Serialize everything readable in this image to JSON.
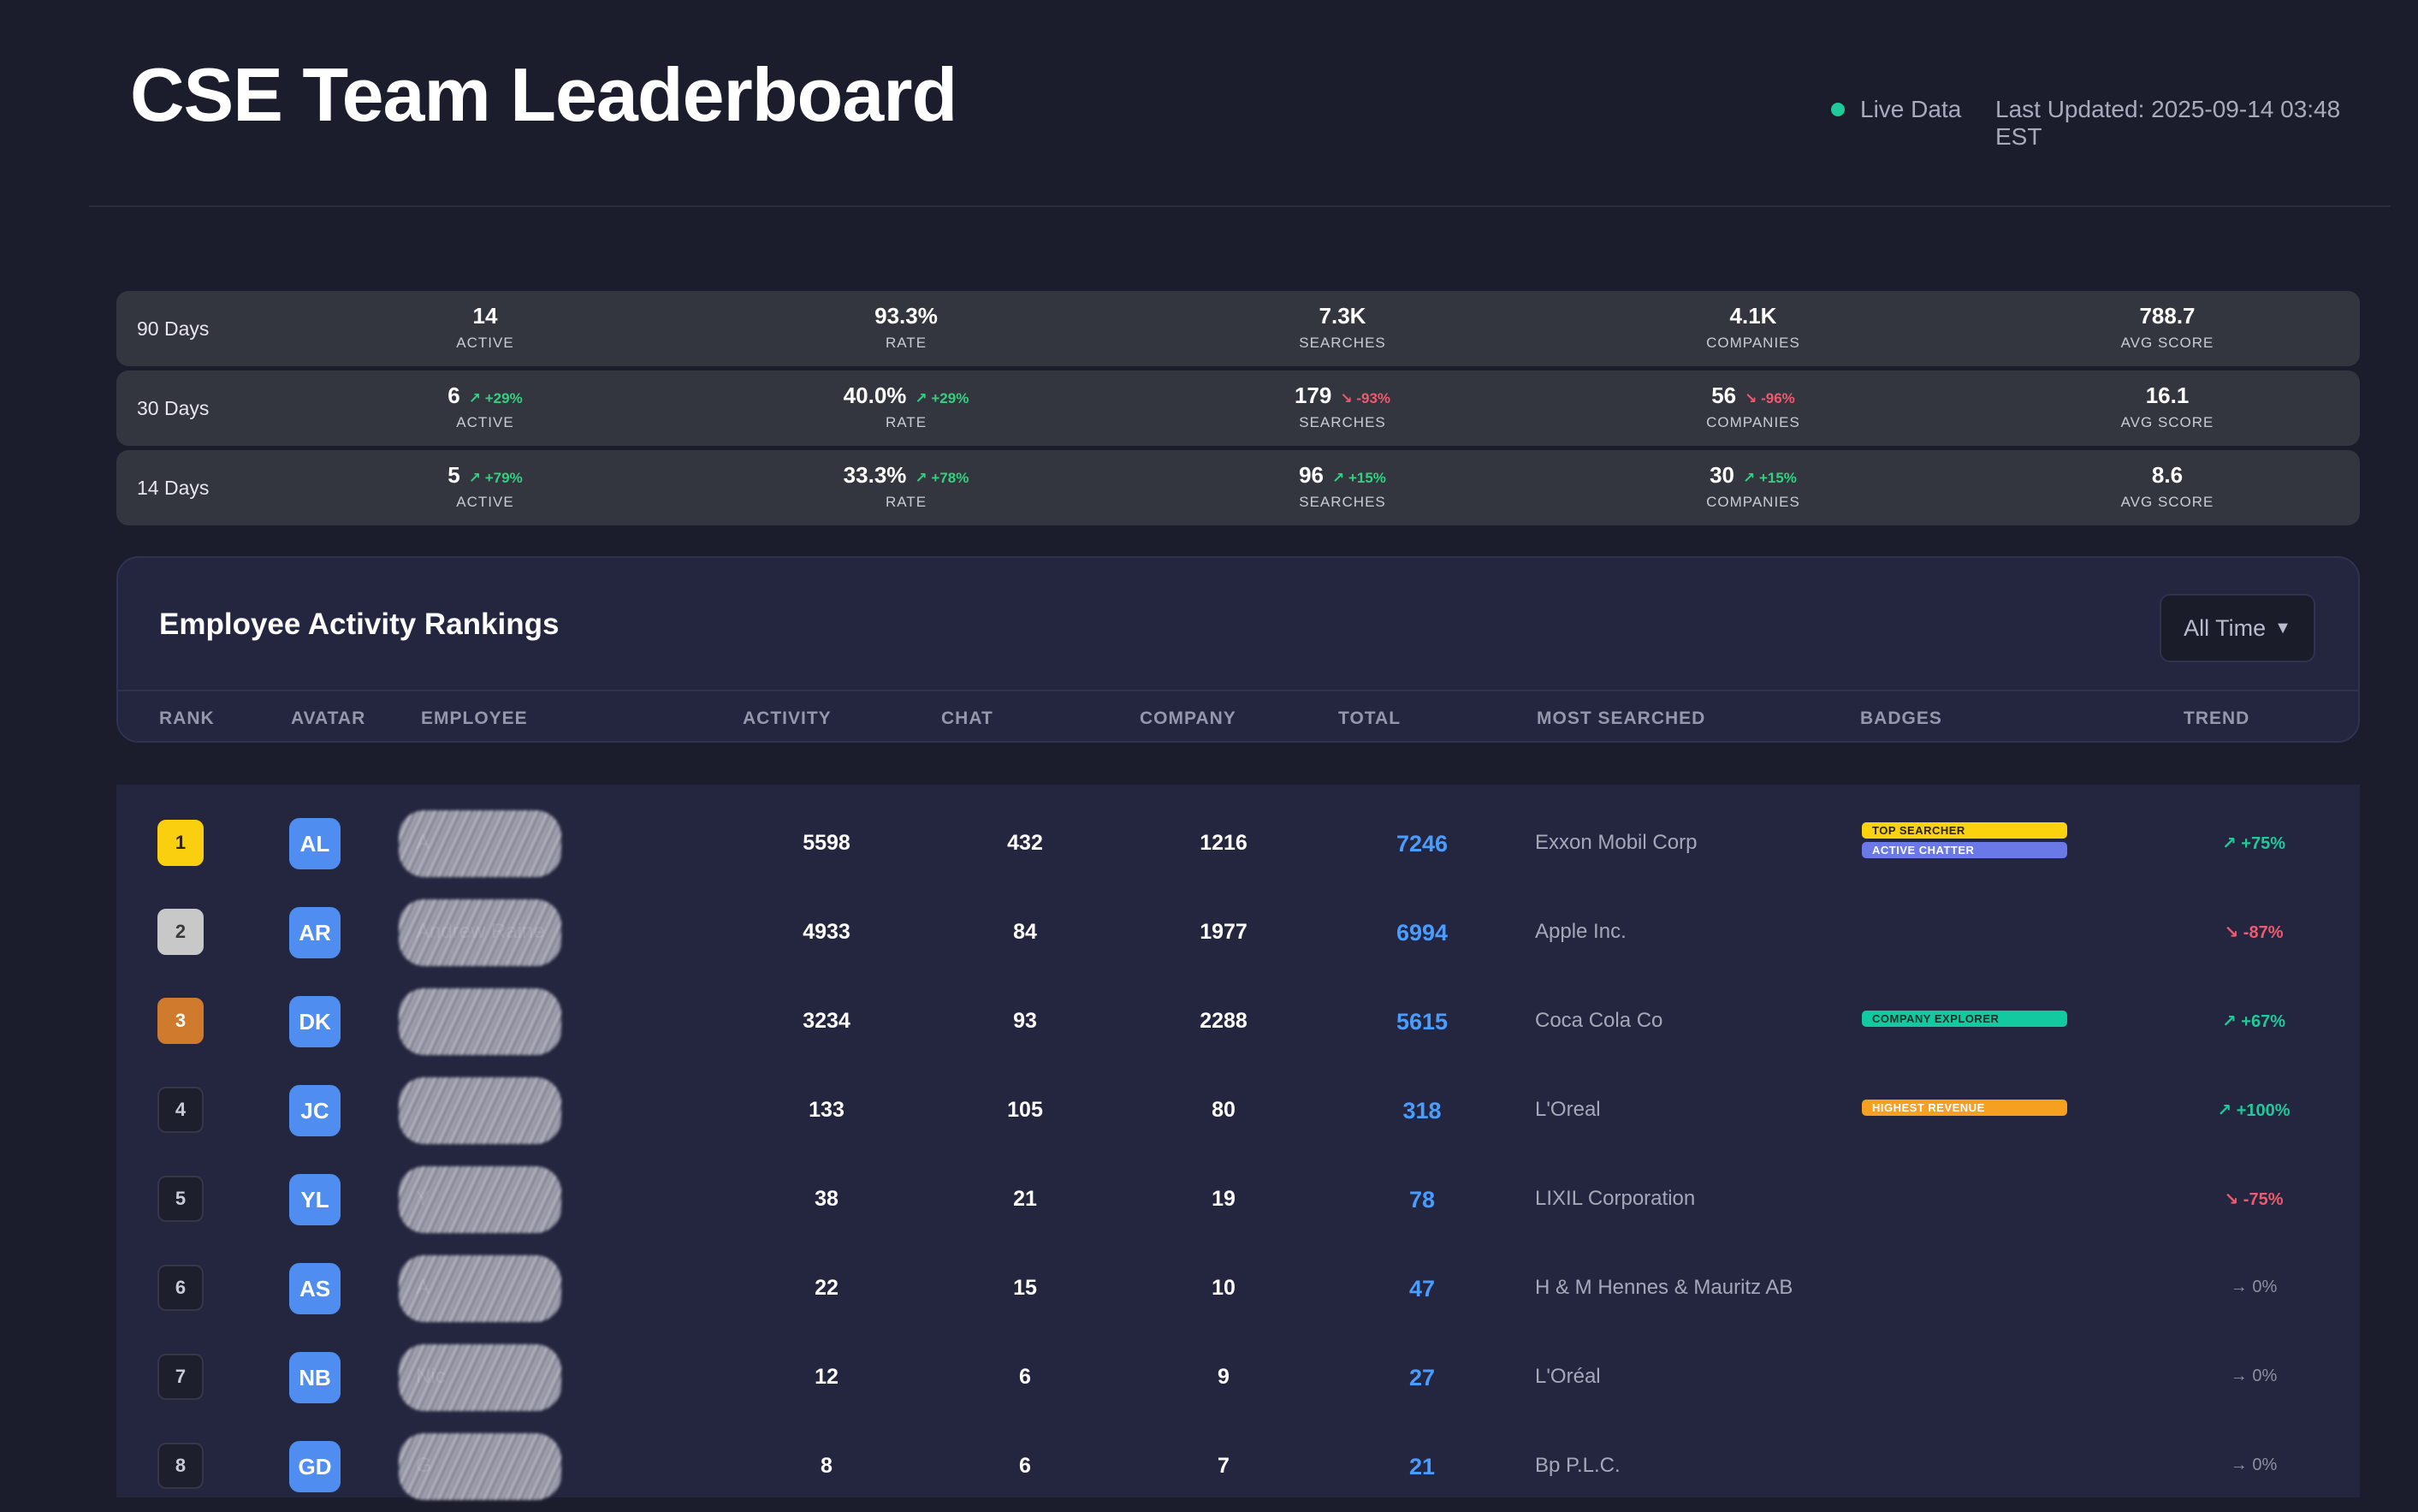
{
  "header": {
    "title": "CSE Team Leaderboard",
    "live_label": "Live Data",
    "last_updated": "Last Updated: 2025-09-14 03:48 EST",
    "live_color": "#1ec99a"
  },
  "stats": [
    {
      "period": "90 Days",
      "cells": [
        {
          "value": "14",
          "change": "",
          "dir": "",
          "label": "ACTIVE"
        },
        {
          "value": "93.3%",
          "change": "",
          "dir": "",
          "label": "RATE"
        },
        {
          "value": "7.3K",
          "change": "",
          "dir": "",
          "label": "SEARCHES"
        },
        {
          "value": "4.1K",
          "change": "",
          "dir": "",
          "label": "COMPANIES"
        },
        {
          "value": "788.7",
          "change": "",
          "dir": "",
          "label": "AVG SCORE"
        }
      ]
    },
    {
      "period": "30 Days",
      "cells": [
        {
          "value": "6",
          "change": "↗ +29%",
          "dir": "up",
          "label": "ACTIVE"
        },
        {
          "value": "40.0%",
          "change": "↗ +29%",
          "dir": "up",
          "label": "RATE"
        },
        {
          "value": "179",
          "change": "↘ -93%",
          "dir": "down",
          "label": "SEARCHES"
        },
        {
          "value": "56",
          "change": "↘ -96%",
          "dir": "down",
          "label": "COMPANIES"
        },
        {
          "value": "16.1",
          "change": "",
          "dir": "",
          "label": "AVG SCORE"
        }
      ]
    },
    {
      "period": "14 Days",
      "cells": [
        {
          "value": "5",
          "change": "↗ +79%",
          "dir": "up",
          "label": "ACTIVE"
        },
        {
          "value": "33.3%",
          "change": "↗ +78%",
          "dir": "up",
          "label": "RATE"
        },
        {
          "value": "96",
          "change": "↗ +15%",
          "dir": "up",
          "label": "SEARCHES"
        },
        {
          "value": "30",
          "change": "↗ +15%",
          "dir": "up",
          "label": "COMPANIES"
        },
        {
          "value": "8.6",
          "change": "",
          "dir": "",
          "label": "AVG SCORE"
        }
      ]
    }
  ],
  "rankings": {
    "title": "Employee Activity Rankings",
    "range_select": "All Time",
    "columns": [
      "RANK",
      "AVATAR",
      "EMPLOYEE",
      "ACTIVITY",
      "CHAT",
      "COMPANY",
      "TOTAL",
      "MOST SEARCHED",
      "BADGES",
      "TREND"
    ],
    "rows": [
      {
        "rank": "1",
        "medal": "gold",
        "avatar": "AL",
        "name": "A",
        "activity": "5598",
        "chat": "432",
        "company": "1216",
        "total": "7246",
        "most_searched": "Exxon Mobil Corp",
        "badges": [
          {
            "label": "TOP SEARCHER",
            "style": "b-yellow"
          },
          {
            "label": "ACTIVE CHATTER",
            "style": "b-indigo"
          }
        ],
        "trend": "↗ +75%",
        "trend_dir": "up"
      },
      {
        "rank": "2",
        "medal": "silver",
        "avatar": "AR",
        "name": "Andrew Raine",
        "activity": "4933",
        "chat": "84",
        "company": "1977",
        "total": "6994",
        "most_searched": "Apple Inc.",
        "badges": [],
        "trend": "↘ -87%",
        "trend_dir": "down"
      },
      {
        "rank": "3",
        "medal": "bronze",
        "avatar": "DK",
        "name": "",
        "activity": "3234",
        "chat": "93",
        "company": "2288",
        "total": "5615",
        "most_searched": "Coca Cola Co",
        "badges": [
          {
            "label": "COMPANY EXPLORER",
            "style": "b-teal"
          }
        ],
        "trend": "↗ +67%",
        "trend_dir": "up"
      },
      {
        "rank": "4",
        "medal": "",
        "avatar": "JC",
        "name": "",
        "activity": "133",
        "chat": "105",
        "company": "80",
        "total": "318",
        "most_searched": "L'Oreal",
        "badges": [
          {
            "label": "HIGHEST REVENUE",
            "style": "b-orange"
          }
        ],
        "trend": "↗ +100%",
        "trend_dir": "up"
      },
      {
        "rank": "5",
        "medal": "",
        "avatar": "YL",
        "name": "Y",
        "activity": "38",
        "chat": "21",
        "company": "19",
        "total": "78",
        "most_searched": "LIXIL Corporation",
        "badges": [],
        "trend": "↘ -75%",
        "trend_dir": "down"
      },
      {
        "rank": "6",
        "medal": "",
        "avatar": "AS",
        "name": "A",
        "activity": "22",
        "chat": "15",
        "company": "10",
        "total": "47",
        "most_searched": "H & M Hennes & Mauritz AB",
        "badges": [],
        "trend": "→ 0%",
        "trend_dir": "flat"
      },
      {
        "rank": "7",
        "medal": "",
        "avatar": "NB",
        "name": "Nic",
        "activity": "12",
        "chat": "6",
        "company": "9",
        "total": "27",
        "most_searched": "L'Oréal",
        "badges": [],
        "trend": "→ 0%",
        "trend_dir": "flat"
      },
      {
        "rank": "8",
        "medal": "",
        "avatar": "GD",
        "name": "G",
        "activity": "8",
        "chat": "6",
        "company": "7",
        "total": "21",
        "most_searched": "Bp P.L.C.",
        "badges": [],
        "trend": "→ 0%",
        "trend_dir": "flat"
      }
    ]
  }
}
